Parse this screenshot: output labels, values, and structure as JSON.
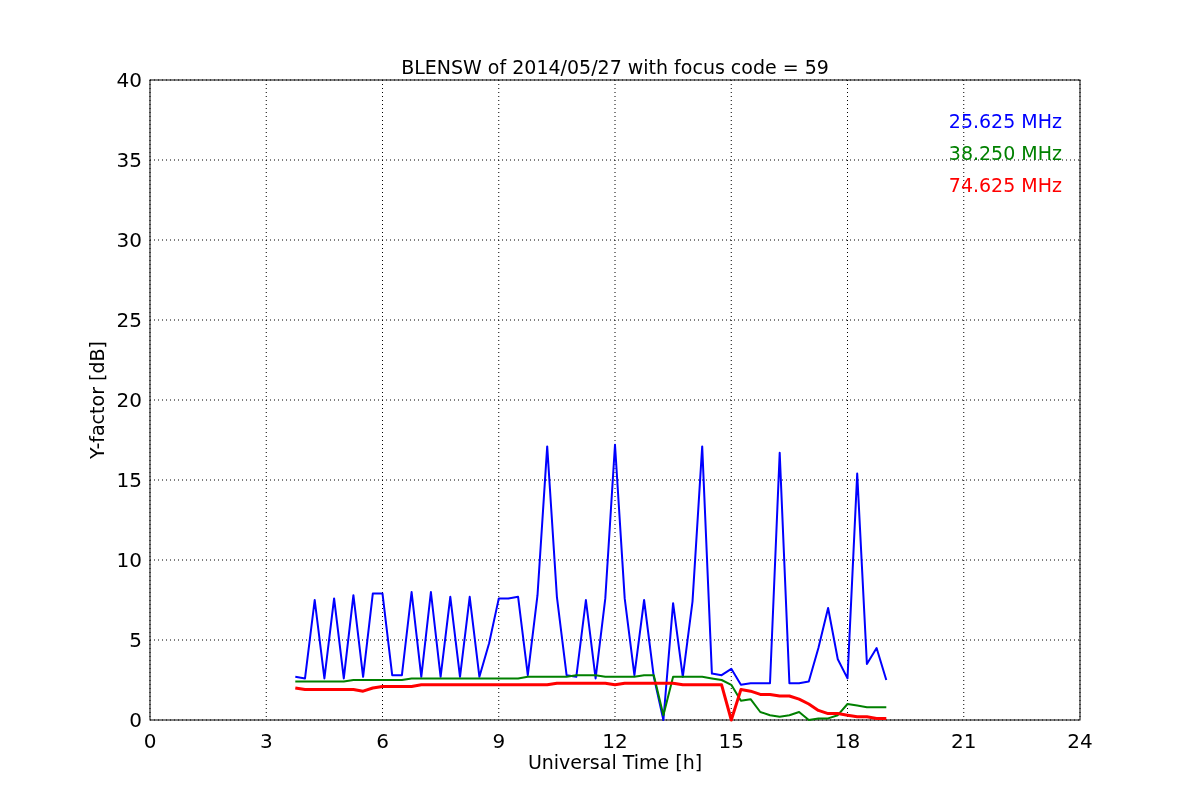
{
  "figure": {
    "chart_data": {
      "type": "line",
      "title": "BLENSW of 2014/05/27 with focus code = 59",
      "xlabel": "Universal Time [h]",
      "ylabel": "Y-factor [dB]",
      "x": [
        3.75,
        4,
        4.25,
        4.5,
        4.75,
        5,
        5.25,
        5.5,
        5.75,
        6,
        6.25,
        6.5,
        6.75,
        7,
        7.25,
        7.5,
        7.75,
        8,
        8.25,
        8.5,
        8.75,
        9,
        9.25,
        9.5,
        9.75,
        10,
        10.25,
        10.5,
        10.75,
        11,
        11.25,
        11.5,
        11.75,
        12,
        12.25,
        12.5,
        12.75,
        13,
        13.25,
        13.5,
        13.75,
        14,
        14.25,
        14.5,
        14.75,
        15,
        15.25,
        15.5,
        15.75,
        16,
        16.25,
        16.5,
        16.75,
        17,
        17.25,
        17.5,
        17.75,
        18,
        18.25,
        18.5,
        18.75,
        19
      ],
      "series": [
        {
          "name": "25.625 MHz",
          "color": "#0000ff",
          "values": [
            2.7,
            2.6,
            7.5,
            2.6,
            7.6,
            2.6,
            7.8,
            2.7,
            7.9,
            7.9,
            2.8,
            2.8,
            8.0,
            2.7,
            8.0,
            2.7,
            7.7,
            2.7,
            7.7,
            2.7,
            4.8,
            7.6,
            7.6,
            7.7,
            2.8,
            7.8,
            17.1,
            7.7,
            2.8,
            2.7,
            7.5,
            2.6,
            7.6,
            17.2,
            7.6,
            2.8,
            7.5,
            2.7,
            0,
            7.3,
            2.7,
            7.4,
            17.1,
            2.9,
            2.8,
            3.2,
            2.2,
            2.3,
            2.3,
            2.3,
            16.7,
            2.3,
            2.3,
            2.4,
            4.5,
            7.0,
            3.8,
            2.6,
            15.4,
            3.5,
            4.5,
            2.5
          ]
        },
        {
          "name": "38.250 MHz",
          "color": "#008000",
          "values": [
            2.4,
            2.4,
            2.4,
            2.4,
            2.4,
            2.4,
            2.5,
            2.5,
            2.5,
            2.5,
            2.5,
            2.5,
            2.6,
            2.6,
            2.6,
            2.6,
            2.6,
            2.6,
            2.6,
            2.6,
            2.6,
            2.6,
            2.6,
            2.6,
            2.7,
            2.7,
            2.7,
            2.7,
            2.7,
            2.8,
            2.8,
            2.8,
            2.7,
            2.7,
            2.7,
            2.7,
            2.8,
            2.8,
            0.3,
            2.7,
            2.7,
            2.7,
            2.7,
            2.6,
            2.5,
            2.2,
            1.2,
            1.3,
            0.5,
            0.3,
            0.2,
            0.3,
            0.5,
            0.0,
            0.1,
            0.1,
            0.3,
            1.0,
            0.9,
            0.8,
            0.8,
            0.8
          ]
        },
        {
          "name": "74.625 MHz",
          "color": "#ff0000",
          "values": [
            2.0,
            1.9,
            1.9,
            1.9,
            1.9,
            1.9,
            1.9,
            1.8,
            2.0,
            2.1,
            2.1,
            2.1,
            2.1,
            2.2,
            2.2,
            2.2,
            2.2,
            2.2,
            2.2,
            2.2,
            2.2,
            2.2,
            2.2,
            2.2,
            2.2,
            2.2,
            2.2,
            2.3,
            2.3,
            2.3,
            2.3,
            2.3,
            2.3,
            2.2,
            2.3,
            2.3,
            2.3,
            2.3,
            2.3,
            2.3,
            2.2,
            2.2,
            2.2,
            2.2,
            2.2,
            0,
            1.9,
            1.8,
            1.6,
            1.6,
            1.5,
            1.5,
            1.3,
            1.0,
            0.6,
            0.4,
            0.4,
            0.3,
            0.2,
            0.2,
            0.1,
            0.1
          ]
        }
      ],
      "grid": true,
      "xlim": [
        0,
        24
      ],
      "ylim": [
        0,
        40
      ],
      "xticks": [
        0,
        3,
        6,
        9,
        12,
        15,
        18,
        21,
        24
      ],
      "yticks": [
        0,
        5,
        10,
        15,
        20,
        25,
        30,
        35,
        40
      ]
    }
  }
}
